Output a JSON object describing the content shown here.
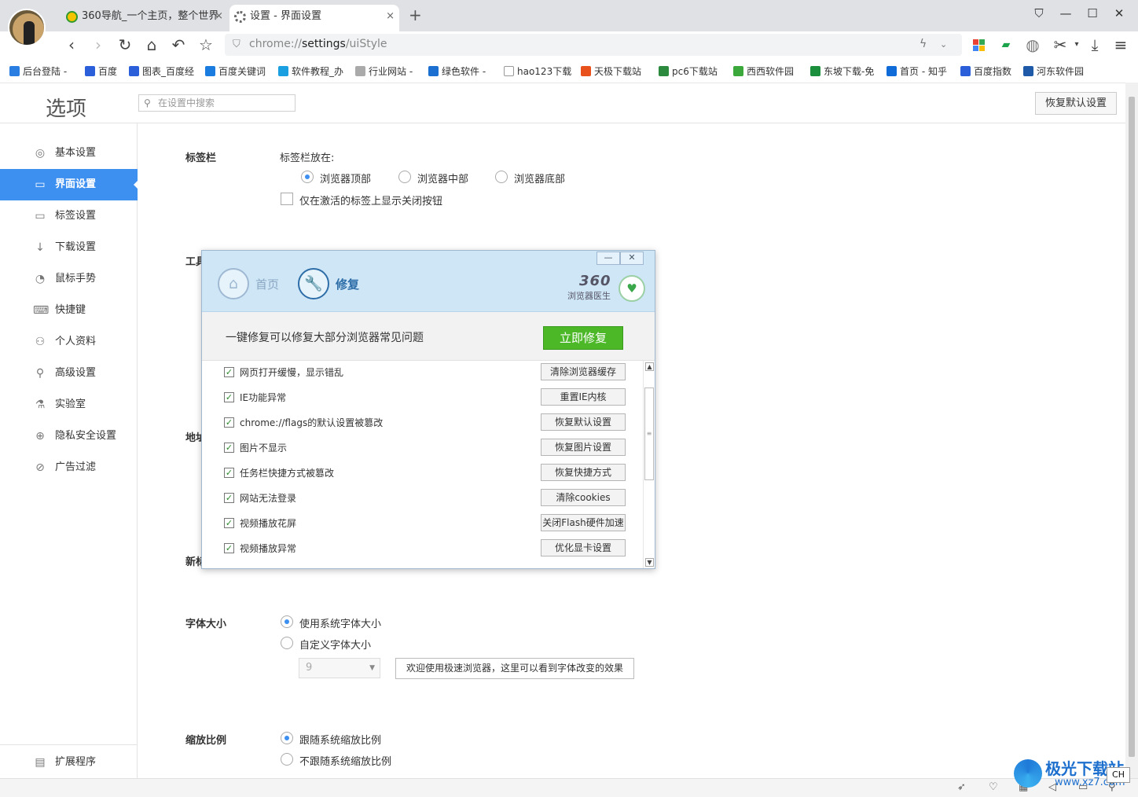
{
  "tabs": [
    {
      "title": "360导航_一个主页，整个世界",
      "close": "×"
    },
    {
      "title": "设置 - 界面设置",
      "close": "×"
    }
  ],
  "new_tab": "+",
  "window_controls": {
    "pin": "⛉",
    "minimize": "—",
    "maximize": "☐",
    "close": "✕"
  },
  "toolbar": {
    "url_prefix": "chrome://",
    "url_host": "settings",
    "url_path": "/uiStyle"
  },
  "bookmarks": [
    {
      "label": "后台登陆 -",
      "color": "#2a7de1"
    },
    {
      "label": "百度",
      "color": "#2b5fd9"
    },
    {
      "label": "图表_百度经",
      "color": "#2b5fd9"
    },
    {
      "label": "百度关键词",
      "color": "#1b7ce0"
    },
    {
      "label": "软件教程_办",
      "color": "#1aa0e0"
    },
    {
      "label": "行业网站 -",
      "color": "#aaaaaa"
    },
    {
      "label": "绿色软件 -",
      "color": "#1a6fd1"
    },
    {
      "label": "hao123下载",
      "color": "#cccccc"
    },
    {
      "label": "天极下载站",
      "color": "#e8501c"
    },
    {
      "label": "pc6下载站",
      "color": "#2b8a3e"
    },
    {
      "label": "西西软件园",
      "color": "#3aa83a"
    },
    {
      "label": "东坡下载-免",
      "color": "#1c8f3c"
    },
    {
      "label": "首页 - 知乎",
      "color": "#0f6bd8"
    },
    {
      "label": "百度指数",
      "color": "#2b5fd9"
    },
    {
      "label": "河东软件园",
      "color": "#1f5aa8"
    }
  ],
  "settings": {
    "title": "选项",
    "search_placeholder": "在设置中搜索",
    "restore_defaults": "恢复默认设置",
    "nav": [
      {
        "label": "基本设置",
        "icon": "◎"
      },
      {
        "label": "界面设置",
        "icon": "▭",
        "active": true
      },
      {
        "label": "标签设置",
        "icon": "▭"
      },
      {
        "label": "下载设置",
        "icon": "↓"
      },
      {
        "label": "鼠标手势",
        "icon": "◔"
      },
      {
        "label": "快捷键",
        "icon": "⌨"
      },
      {
        "label": "个人资料",
        "icon": "⚇"
      },
      {
        "label": "高级设置",
        "icon": "⚲"
      },
      {
        "label": "实验室",
        "icon": "⚗"
      },
      {
        "label": "隐私安全设置",
        "icon": "⊕"
      },
      {
        "label": "广告过滤",
        "icon": "⊘"
      }
    ],
    "extensions": {
      "label": "扩展程序",
      "icon": "▤"
    },
    "tabbar": {
      "title": "标签栏",
      "position_label": "标签栏放在:",
      "options": [
        "浏览器顶部",
        "浏览器中部",
        "浏览器底部"
      ],
      "close_on_active": "仅在激活的标签上显示关闭按钮"
    },
    "toolbar_title_partial": "工具",
    "address_title_partial": "地址",
    "newtab_title_partial": "新标",
    "font": {
      "title": "字体大小",
      "options": [
        "使用系统字体大小",
        "自定义字体大小"
      ],
      "size_value": "9",
      "preview": "欢迎使用极速浏览器，这里可以看到字体改变的效果"
    },
    "zoom": {
      "title": "缩放比例",
      "options": [
        "跟随系统缩放比例",
        "不跟随系统缩放比例"
      ]
    }
  },
  "dialog": {
    "tab_home": "首页",
    "tab_repair": "修复",
    "brand_number": "360",
    "brand_name": "浏览器医生",
    "minimize": "—",
    "close": "✕",
    "hint": "一键修复可以修复大部分浏览器常见问题",
    "fix_button": "立即修复",
    "items": [
      {
        "text": "网页打开缓慢，显示错乱",
        "action": "清除浏览器缓存"
      },
      {
        "text": "IE功能异常",
        "action": "重置IE内核"
      },
      {
        "text": "chrome://flags的默认设置被篡改",
        "action": "恢复默认设置"
      },
      {
        "text": "图片不显示",
        "action": "恢复图片设置"
      },
      {
        "text": "任务栏快捷方式被篡改",
        "action": "恢复快捷方式"
      },
      {
        "text": "网站无法登录",
        "action": "清除cookies"
      },
      {
        "text": "视频播放花屏",
        "action": "关闭Flash硬件加速"
      },
      {
        "text": "视频播放异常",
        "action": "优化显卡设置"
      }
    ]
  },
  "watermark": {
    "name": "极光下载站",
    "url": "www.xz7.com"
  },
  "ime": "CH"
}
